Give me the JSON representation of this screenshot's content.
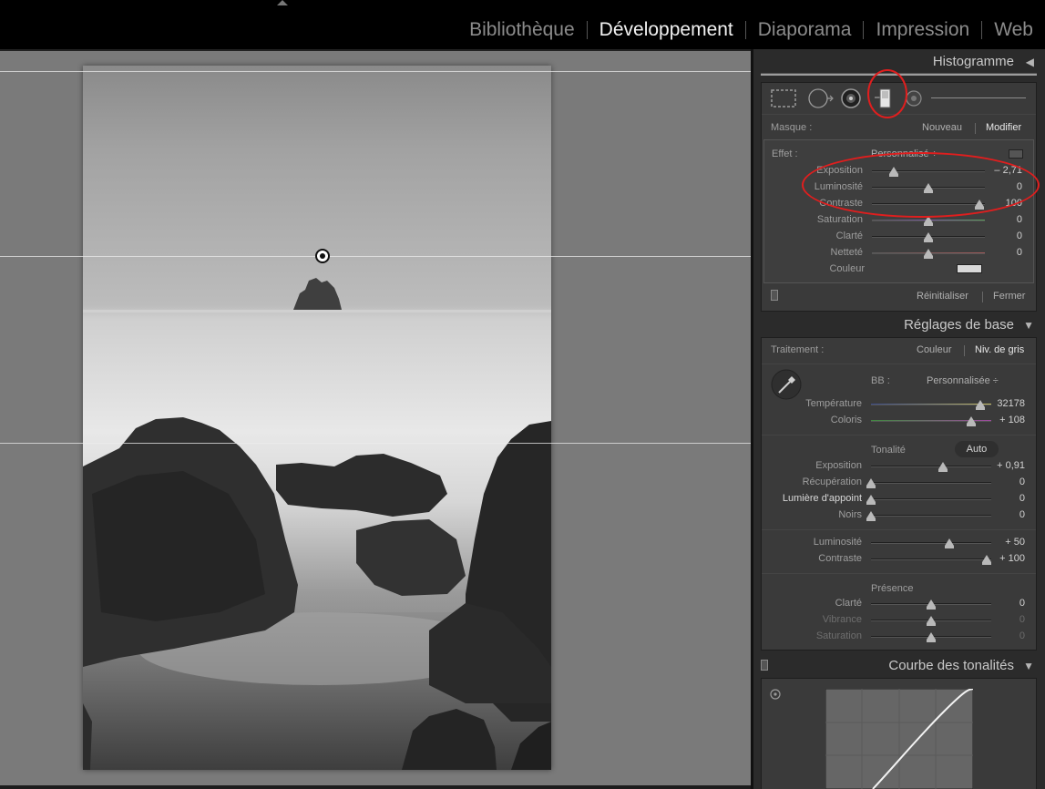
{
  "modules": [
    "Bibliothèque",
    "Développement",
    "Diaporama",
    "Impression",
    "Web"
  ],
  "active_module": "Développement",
  "histogram": {
    "title": "Histogramme",
    "toggle": "◀"
  },
  "mask": {
    "label": "Masque :",
    "new": "Nouveau",
    "edit": "Modifier"
  },
  "effect": {
    "label": "Effet :",
    "preset": "Personnalisé ÷"
  },
  "local_sliders": [
    {
      "label": "Exposition",
      "value": "– 2,71",
      "pos": 0.19
    },
    {
      "label": "Luminosité",
      "value": "0",
      "pos": 0.5
    },
    {
      "label": "Contraste",
      "value": "100",
      "pos": 0.95
    },
    {
      "label": "Saturation",
      "value": "0",
      "pos": 0.5
    },
    {
      "label": "Clarté",
      "value": "0",
      "pos": 0.5
    },
    {
      "label": "Netteté",
      "value": "0",
      "pos": 0.5
    }
  ],
  "color_label": "Couleur",
  "mask_footer": {
    "reset": "Réinitialiser",
    "close": "Fermer"
  },
  "basic": {
    "title": "Réglages de base",
    "toggle": "▼",
    "treatment_label": "Traitement :",
    "color": "Couleur",
    "grayscale": "Niv. de gris",
    "wb_label": "BB :",
    "wb_value": "Personnalisée ÷",
    "temperature": {
      "label": "Température",
      "value": "32178",
      "pos": 0.91
    },
    "tint": {
      "label": "Coloris",
      "value": "+ 108",
      "pos": 0.83
    },
    "tone_label": "Tonalité",
    "auto": "Auto",
    "exposure": {
      "label": "Exposition",
      "value": "+ 0,91",
      "pos": 0.6
    },
    "recovery": {
      "label": "Récupération",
      "value": "0",
      "pos": 0.0
    },
    "fill_light": {
      "label": "Lumière d'appoint",
      "value": "0",
      "pos": 0.0
    },
    "blacks": {
      "label": "Noirs",
      "value": "0",
      "pos": 0.0
    },
    "brightness": {
      "label": "Luminosité",
      "value": "+ 50",
      "pos": 0.65
    },
    "contrast": {
      "label": "Contraste",
      "value": "+ 100",
      "pos": 0.96
    },
    "presence_label": "Présence",
    "clarity": {
      "label": "Clarté",
      "value": "0",
      "pos": 0.5
    },
    "vibrance": {
      "label": "Vibrance",
      "value": "0",
      "pos": 0.5
    },
    "saturation": {
      "label": "Saturation",
      "value": "0",
      "pos": 0.5
    }
  },
  "curve": {
    "title": "Courbe des tonalités",
    "toggle": "▼"
  },
  "annotation_color": "#e01e1e"
}
